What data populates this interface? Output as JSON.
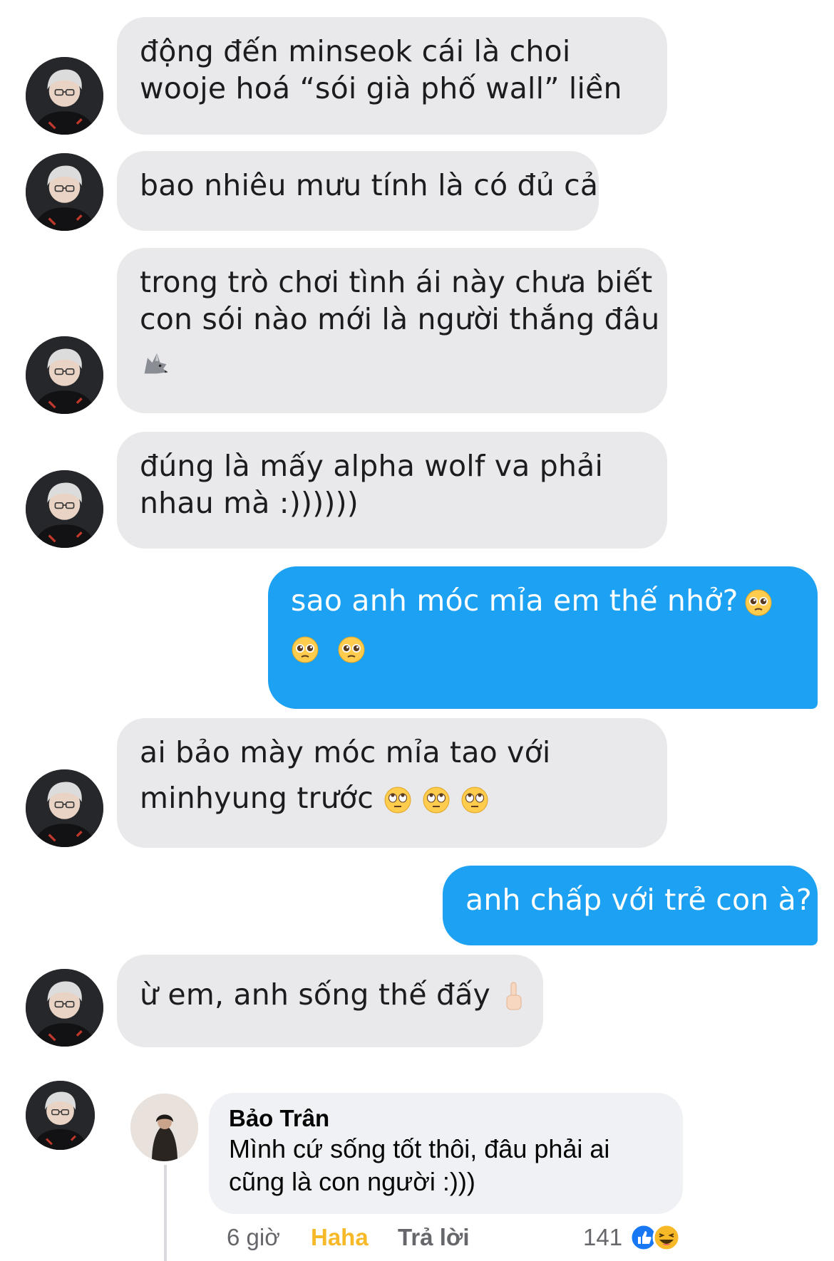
{
  "messages": [
    {
      "side": "in",
      "lines": [
        "động đến minseok cái là choi",
        "wooje hoá “sói già phố wall” liền"
      ]
    },
    {
      "side": "in",
      "lines": [
        "bao nhiêu mưu tính là có đủ cả"
      ]
    },
    {
      "side": "in",
      "lines": [
        "trong trò chơi tình ái này chưa biết",
        "con sói nào mới là người thắng đâu"
      ],
      "emoji": "wolf-emoji"
    },
    {
      "side": "in",
      "lines": [
        "đúng là mấy alpha wolf va phải",
        "nhau mà :))))))"
      ]
    },
    {
      "side": "out",
      "lines": [
        "sao anh móc mỉa em thế nhở?"
      ],
      "emoji": "pleading-face-emoji"
    },
    {
      "side": "in",
      "lines": [
        "ai bảo mày móc mỉa tao với",
        "minhyung trước"
      ],
      "emoji": "eye-roll-emoji"
    },
    {
      "side": "out",
      "lines": [
        "anh chấp với trẻ con à?"
      ]
    },
    {
      "side": "in",
      "lines": [
        "ừ em, anh sống thế đấy"
      ],
      "emoji": "finger-emoji"
    }
  ],
  "comment": {
    "author": "Bảo Trân",
    "text_lines": [
      "Mình cứ sống tốt thôi, đâu phải ai",
      "cũng là con người :)))"
    ],
    "time": "6 giờ",
    "reaction_label": "Haha",
    "reply_label": "Trả lời",
    "reaction_count": "141",
    "reaction_icons": [
      "like-icon",
      "haha-icon"
    ]
  },
  "colors": {
    "incoming_bubble": "#e9e9eb",
    "outgoing_bubble": "#1da1f2",
    "haha_label": "#f7b928"
  }
}
